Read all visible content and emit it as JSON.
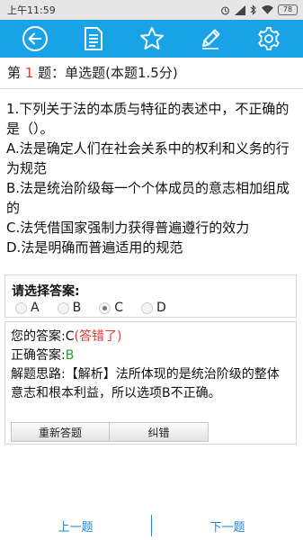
{
  "status": {
    "time": "上午11:59",
    "battery": "78",
    "icons": [
      "alarm-icon",
      "signal-icon",
      "bluetooth-icon",
      "wifi-icon",
      "battery-icon"
    ]
  },
  "toolbar": {
    "background": "#19a2e6",
    "icons": [
      "back-arrow-icon",
      "document-list-icon",
      "star-icon",
      "pencil-icon",
      "gear-icon"
    ]
  },
  "question": {
    "prefix": "第",
    "number": "1",
    "suffix": "题：单选题(本题1.5分)",
    "stem": "1.下列关于法的本质与特征的表述中，不正确的是（）。",
    "options": [
      "A.法是确定人们在社会关系中的权利和义务的行为规范",
      "B.法是统治阶级每一个个体成员的意志相加组成的",
      "C.法凭借国家强制力获得普遍遵行的效力",
      "D.法是明确而普遍适用的规范"
    ]
  },
  "answer": {
    "title": "请选择答案:",
    "options": [
      "A",
      "B",
      "C",
      "D"
    ],
    "selected": "C"
  },
  "result": {
    "your_label": "您的答案:",
    "your_value": "C",
    "wrong_text": "(答错了)",
    "correct_label": "正确答案:",
    "correct_value": "B",
    "analysis_label": "解题思路:",
    "analysis": "【解析】法所体现的是统治阶级的整体意志和根本利益，所以选项B不正确。",
    "retry_label": "重新答题",
    "correct_error_label": "纠错"
  },
  "nav": {
    "prev": "上一题",
    "next": "下一题",
    "color": "#1e88d8"
  }
}
